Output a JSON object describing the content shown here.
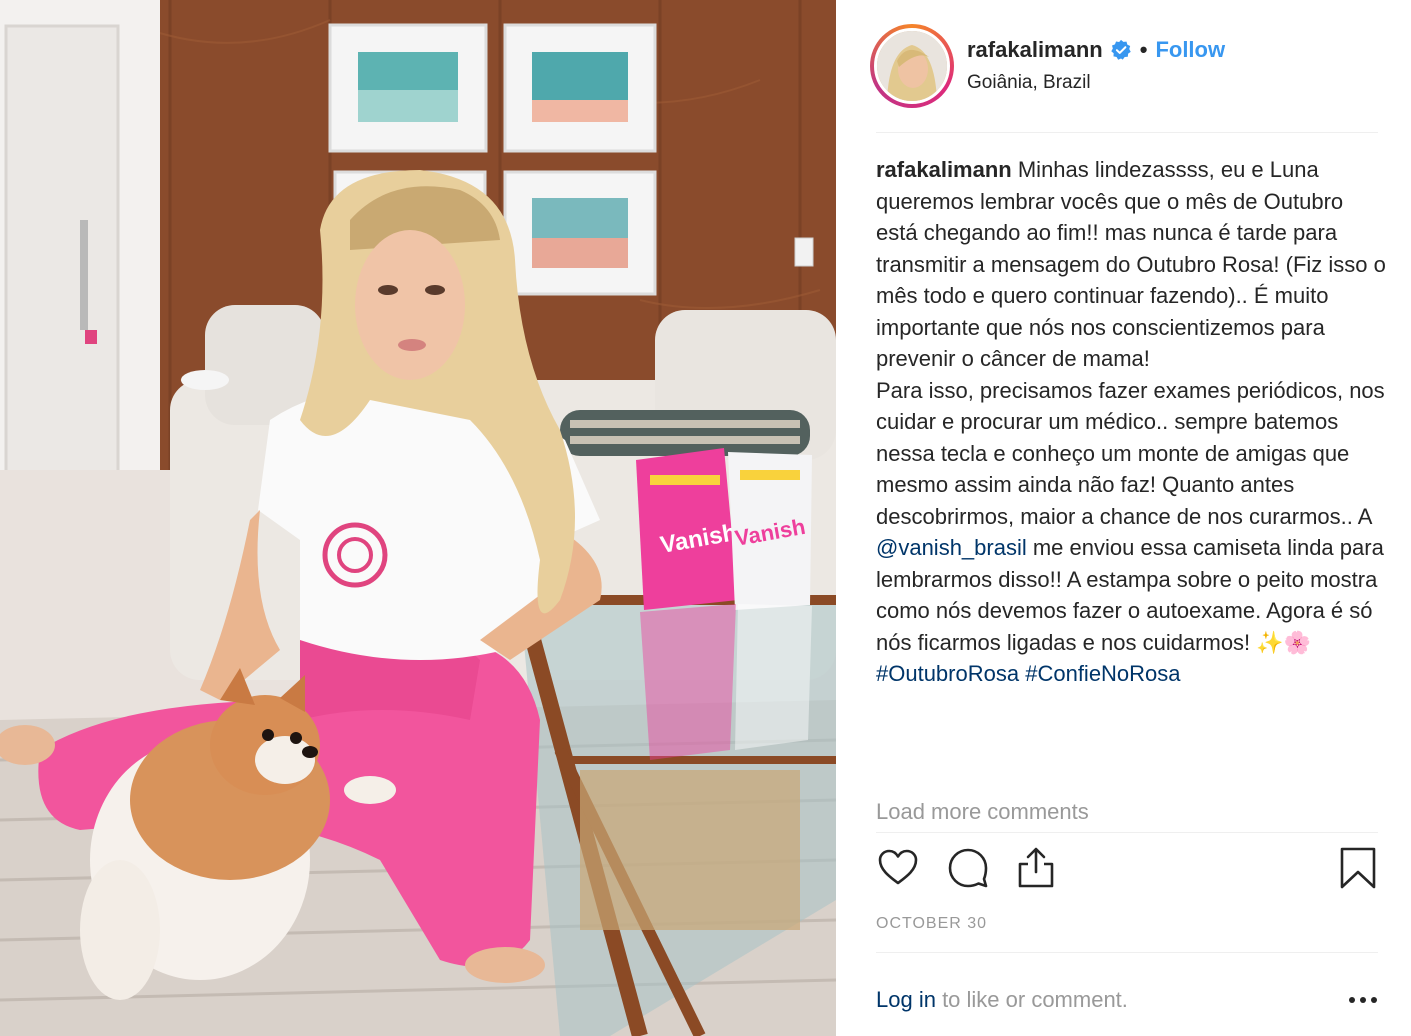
{
  "post": {
    "username": "rafakalimann",
    "separator": "•",
    "follow_label": "Follow",
    "location": "Goiânia, Brazil",
    "caption": {
      "username": "rafakalimann",
      "text_1": "Minhas lindezassss, eu e Luna queremos lembrar vocês que o mês de Outubro está chegando ao fim!! mas nunca é tarde para transmitir a mensagem do Outubro Rosa! (Fiz isso o mês todo e quero continuar fazendo).. É muito importante que nós nos conscientizemos para prevenir o câncer de mama!",
      "text_2": "Para isso, precisamos fazer exames periódicos, nos cuidar e procurar um médico.. sempre batemos nessa tecla e conheço um monte de amigas que mesmo assim ainda não faz! Quanto antes descobrirmos, maior a chance de nos curarmos.. A ",
      "mention": "@vanish_brasil",
      "text_3": " me enviou essa camiseta linda para lembrarmos disso!! A estampa sobre o peito mostra como nós devemos fazer o autoexame. Agora é só nós ficarmos ligadas e nos cuidarmos! ✨🌸",
      "hashtag_1": "#OutubroRosa",
      "hashtag_2": "#ConfieNoRosa"
    },
    "load_more": "Load more comments",
    "date": "OCTOBER 30",
    "login_link": "Log in",
    "login_rest": " to like or comment."
  },
  "photo": {
    "product_label": "Vanish"
  },
  "icons": {
    "verified": "verified-badge-icon",
    "like": "heart-icon",
    "comment": "comment-bubble-icon",
    "share": "share-icon",
    "save": "bookmark-icon",
    "more": "more-dots-icon"
  },
  "colors": {
    "follow": "#3897f0",
    "link": "#003569",
    "muted": "#999999",
    "verified": "#3897f0",
    "pants": "#f2559d",
    "product_pink": "#ee3f9c"
  }
}
